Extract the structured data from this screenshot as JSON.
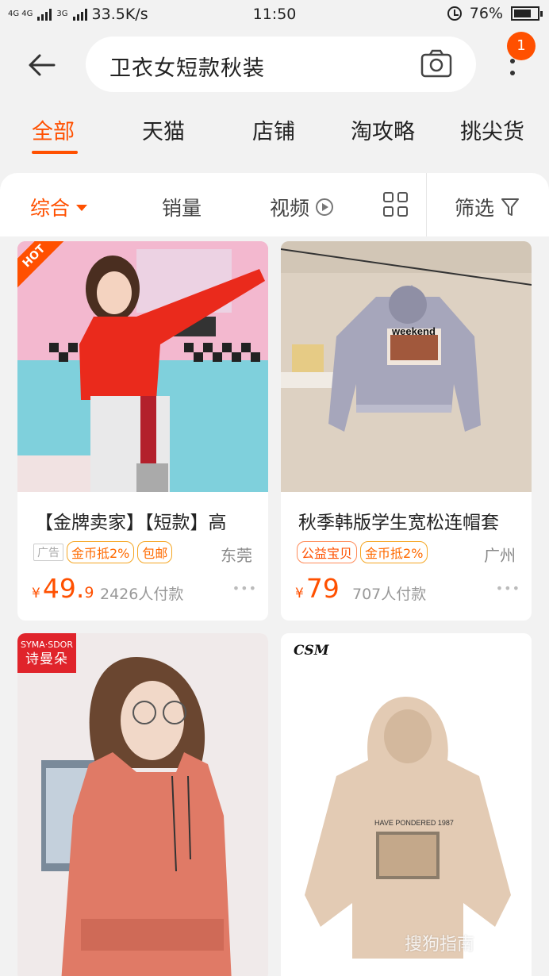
{
  "status_bar": {
    "network": "4G 4G",
    "network_3g": "3G",
    "speed": "33.5K/s",
    "time": "11:50",
    "battery": "76%",
    "battery_level": 0.76
  },
  "header": {
    "search_query": "卫衣女短款秋装",
    "badge_count": "1"
  },
  "tabs": [
    "全部",
    "天猫",
    "店铺",
    "淘攻略",
    "挑尖货"
  ],
  "sort_bar": {
    "comprehensive": "综合",
    "sales": "销量",
    "video": "视频",
    "filter": "筛选"
  },
  "products": [
    {
      "title": "【金牌卖家】【短款】高",
      "ad_label": "广告",
      "tags": [
        "金币抵2%",
        "包邮"
      ],
      "location": "东莞",
      "currency": "¥",
      "price_int": "49.",
      "price_dec": "9",
      "sold": "2426人付款",
      "image_badge": "HOT"
    },
    {
      "title": "秋季韩版学生宽松连帽套",
      "tags": [
        "公益宝贝",
        "金币抵2%"
      ],
      "location": "广州",
      "currency": "¥",
      "price_int": "79",
      "price_dec": "",
      "sold": "707人付款",
      "image_text": "weekend"
    },
    {
      "brand_line1": "SYMA·SDOR",
      "brand_line2": "诗曼朵"
    },
    {
      "brand": "CSM",
      "image_text": "HAVE PONDERED 1987"
    }
  ],
  "watermark": "搜狗指南",
  "colors": {
    "accent": "#ff5000",
    "background": "#f2f2f2"
  }
}
